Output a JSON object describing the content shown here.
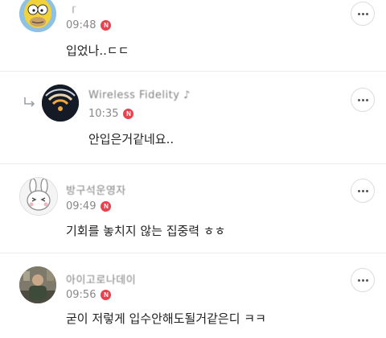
{
  "comments": [
    {
      "nickname": "「",
      "time": "09:48",
      "badge": "N",
      "text": "입었나..ㄷㄷ",
      "avatar": "simpsons-avatar"
    },
    {
      "nickname": "Wireless Fidelity ♪",
      "time": "10:35",
      "badge": "N",
      "text": "안입은거같네요..",
      "avatar": "wifi-avatar",
      "is_reply": true
    },
    {
      "nickname": "방구석운영자",
      "time": "09:49",
      "badge": "N",
      "text": "기회를 놓치지 않는 집중력 ㅎㅎ",
      "avatar": "bunny-avatar"
    },
    {
      "nickname": "아이고로나데이",
      "time": "09:56",
      "badge": "N",
      "text": "굳이 저렇게 입수안해도될거같은디 ㅋㅋ",
      "avatar": "photo-avatar"
    }
  ],
  "colors": {
    "badge": "#e8424f",
    "divider": "#ececec"
  }
}
